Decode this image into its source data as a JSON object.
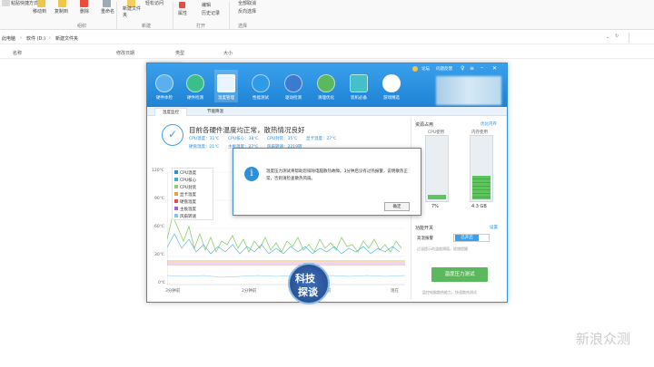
{
  "ribbon": {
    "items": [
      "粘贴快捷方式",
      "移动到",
      "复制到",
      "删除",
      "重命名",
      "新建文件夹",
      "轻松访问",
      "属性",
      "编辑",
      "历史记录",
      "全部取消",
      "反向选择"
    ],
    "groups": [
      "组织",
      "新建",
      "打开",
      "选择"
    ]
  },
  "address": {
    "crumbs": [
      "此电脑",
      "软件 (D:)",
      "新建文件夹"
    ],
    "sep": "›"
  },
  "columns": [
    "名称",
    "修改日期",
    "类型",
    "大小"
  ],
  "app": {
    "top_links": [
      "论坛",
      "问题反馈"
    ],
    "nav": [
      "硬件体检",
      "硬件检测",
      "温度管理",
      "性能测试",
      "驱动检测",
      "清理优化",
      "装机必备",
      "游戏精选"
    ],
    "tabs": [
      "温度监控",
      "节能降温"
    ],
    "status_title": "目前各硬件温度均正常，散热情况良好",
    "temps": [
      "CPU温度：31℃",
      "CPU核心：38℃",
      "CPU封装：35℃",
      "显卡温度：27℃",
      "硬盘温度：21℃",
      "主板温度：27℃",
      "风扇转速：2219转"
    ],
    "legend": [
      "CPU温度",
      "CPU核心",
      "CPU封装",
      "显卡温度",
      "硬盘温度",
      "主板温度",
      "风扇转速"
    ],
    "legend_colors": [
      "#2f8fd8",
      "#3bb0d8",
      "#8fcf6e",
      "#e8a23c",
      "#e84c4c",
      "#b35ad8",
      "#7fc9e8"
    ],
    "yticks": [
      "120℃",
      "90℃",
      "60℃",
      "30℃",
      "0℃"
    ],
    "xticks": [
      "3分钟前",
      "2分钟前",
      "1分钟前",
      "现在"
    ],
    "resource": {
      "title": "资源占用",
      "link": "优化内存",
      "cpu_label": "CPU使用",
      "cpu_val": "7%",
      "mem_label": "内存使用",
      "mem_val": "4.3 GB"
    },
    "func": {
      "title": "功能开关",
      "link": "设置",
      "row_label": "高温报警",
      "toggle": "已开启",
      "desc": "过温提示的温度阈值，欲增提醒",
      "button": "温度压力测试",
      "foot": "监控电脑散热能力，快速散热测试"
    }
  },
  "dialog": {
    "text": "温度压力测试将帮助您排除电脑散热故障。3分钟后没有过热报警，说明散热正常，否则请检查散热风扇。",
    "ok": "确定"
  },
  "watermark": {
    "badge_top": "科技",
    "badge_bottom": "探谈",
    "site": "新浪众测"
  }
}
